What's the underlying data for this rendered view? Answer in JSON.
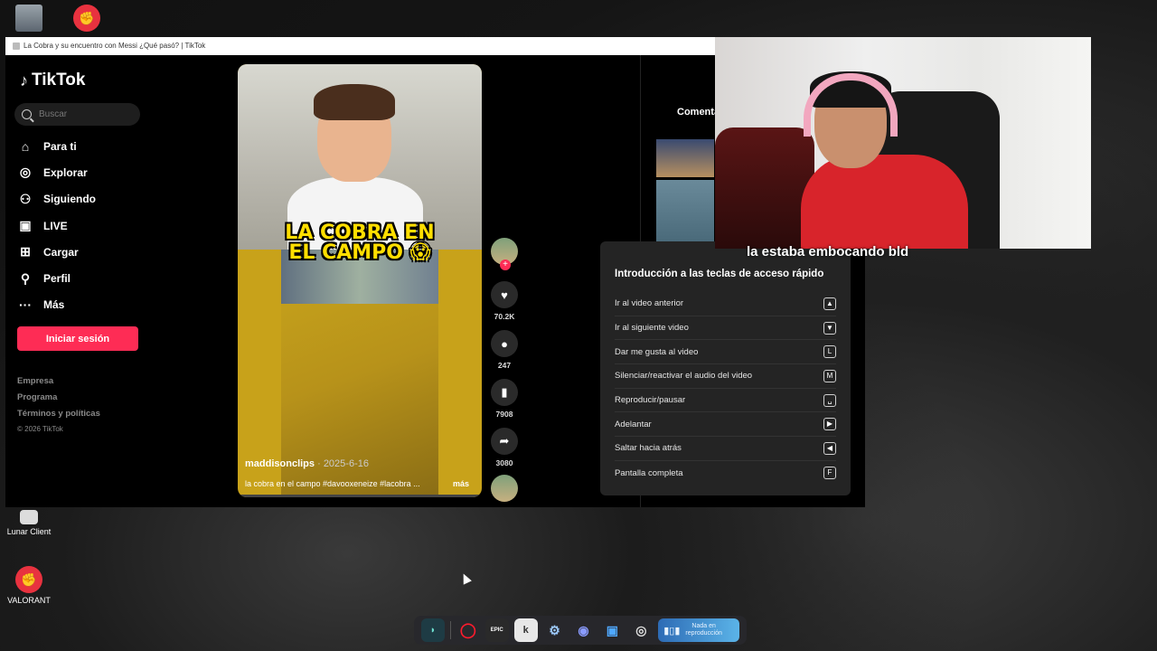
{
  "window": {
    "title": "La Cobra y su encuentro con Messi ¿Qué pasó? | TikTok"
  },
  "desktop": {
    "icons": [
      {
        "label": "",
        "icon": "recycle-bin-icon"
      },
      {
        "label": "",
        "icon": "valorant-icon"
      },
      {
        "label": "Lunar Client",
        "icon": "lunar-client-icon"
      },
      {
        "label": "VALORANT",
        "icon": "valorant-icon"
      }
    ]
  },
  "tiktok": {
    "logo": "TikTok",
    "search_placeholder": "Buscar",
    "nav": [
      {
        "label": "Para ti",
        "icon": "home-icon"
      },
      {
        "label": "Explorar",
        "icon": "compass-icon"
      },
      {
        "label": "Siguiendo",
        "icon": "following-icon"
      },
      {
        "label": "LIVE",
        "icon": "live-icon"
      },
      {
        "label": "Cargar",
        "icon": "upload-icon"
      },
      {
        "label": "Perfil",
        "icon": "profile-icon"
      },
      {
        "label": "Más",
        "icon": "more-icon"
      }
    ],
    "login_button": "Iniciar sesión",
    "footer": {
      "links": [
        "Empresa",
        "Programa",
        "Términos y políticas"
      ],
      "copyright": "© 2026 TikTok"
    },
    "video": {
      "overlay_title_line1": "LA COBRA EN",
      "overlay_title_line2": "EL CAMPO 😱",
      "username": "maddisonclips",
      "date": "· 2025-6-16",
      "description": "la cobra  en el campo #davooxeneize #lacobra ...",
      "more": "más"
    },
    "actions": {
      "likes": "70.2K",
      "comments": "247",
      "saves": "7908",
      "shares": "3080"
    },
    "comments_tab": "Comentarios"
  },
  "shortcuts": {
    "title": "Introducción a las teclas de acceso rápido",
    "rows": [
      {
        "label": "Ir al video anterior",
        "key": "▲"
      },
      {
        "label": "Ir al siguiente video",
        "key": "▼"
      },
      {
        "label": "Dar me gusta al video",
        "key": "L"
      },
      {
        "label": "Silenciar/reactivar el audio del video",
        "key": "M"
      },
      {
        "label": "Reproducir/pausar",
        "key": "␣"
      },
      {
        "label": "Adelantar",
        "key": "▶"
      },
      {
        "label": "Saltar hacia atrás",
        "key": "◀"
      },
      {
        "label": "Pantalla completa",
        "key": "F"
      }
    ]
  },
  "stream": {
    "caption": "la estaba embocando bld"
  },
  "taskbar": {
    "apps": [
      "app-icon",
      "opera-icon",
      "epic-games-icon",
      "kick-icon",
      "steam-icon",
      "discord-icon",
      "app-icon",
      "obs-icon"
    ],
    "epic_label": "EPIC",
    "kick_label": "k",
    "media_text_line1": "Nada en",
    "media_text_line2": "reproducción"
  },
  "colors": {
    "accent": "#fe2c55",
    "caption_yellow": "#ffde00"
  }
}
